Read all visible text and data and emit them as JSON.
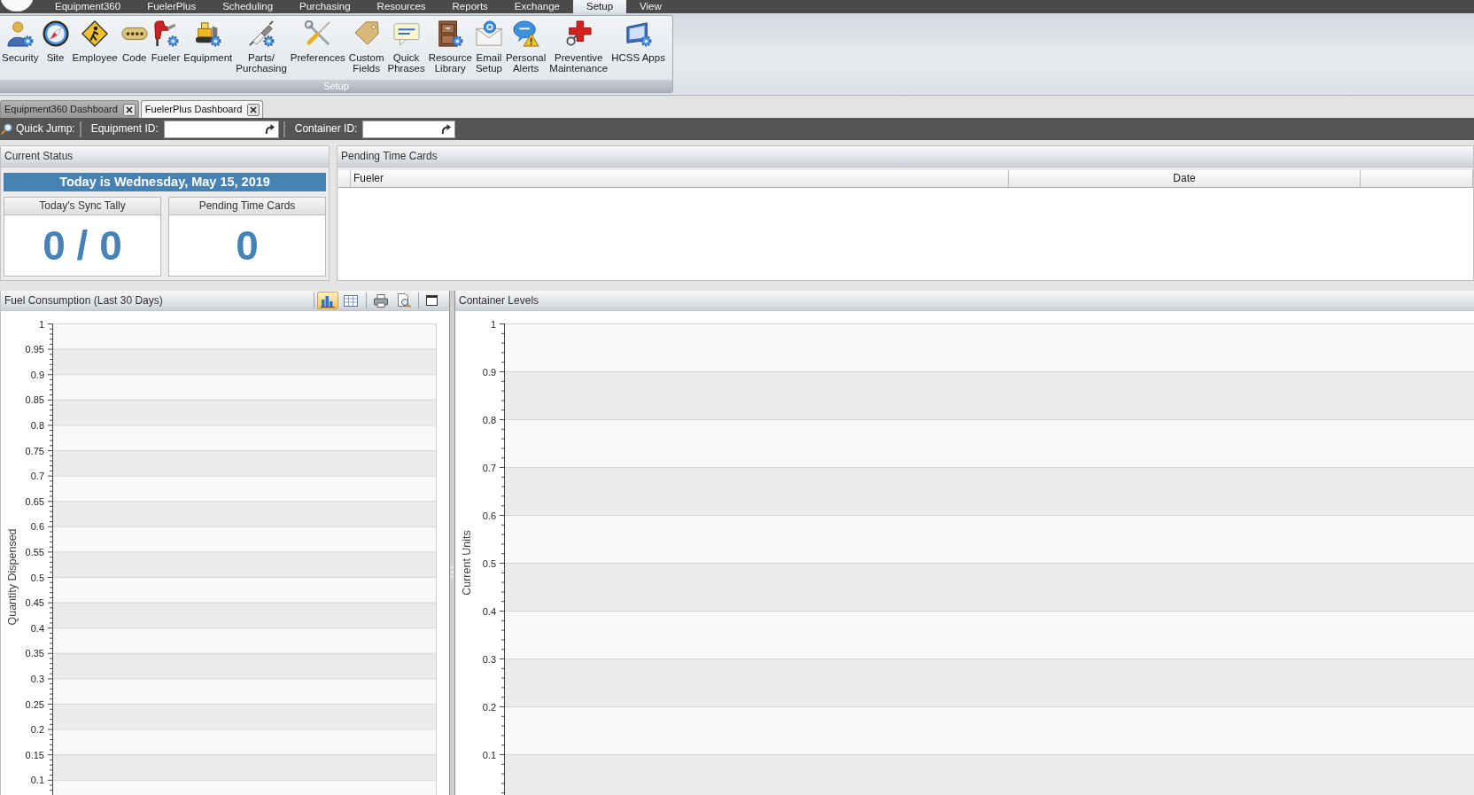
{
  "menu": [
    {
      "label": "Equipment360",
      "selected": false
    },
    {
      "label": "FuelerPlus",
      "selected": false
    },
    {
      "label": "Scheduling",
      "selected": false
    },
    {
      "label": "Purchasing",
      "selected": false
    },
    {
      "label": "Resources",
      "selected": false
    },
    {
      "label": "Reports",
      "selected": false
    },
    {
      "label": "Exchange",
      "selected": false
    },
    {
      "label": "Setup",
      "selected": true
    },
    {
      "label": "View",
      "selected": false
    }
  ],
  "ribbon": {
    "group": "Setup",
    "buttons": [
      {
        "lines": [
          "Security"
        ]
      },
      {
        "lines": [
          "Site"
        ]
      },
      {
        "lines": [
          "Employee"
        ]
      },
      {
        "lines": [
          "Code"
        ]
      },
      {
        "lines": [
          "Fueler"
        ]
      },
      {
        "lines": [
          "Equipment"
        ]
      },
      {
        "lines": [
          "Parts/",
          "Purchasing"
        ]
      },
      {
        "lines": [
          "Preferences"
        ]
      },
      {
        "lines": [
          "Custom",
          "Fields"
        ]
      },
      {
        "lines": [
          "Quick",
          "Phrases"
        ]
      },
      {
        "lines": [
          "Resource",
          "Library"
        ]
      },
      {
        "lines": [
          "Email",
          "Setup"
        ]
      },
      {
        "lines": [
          "Personal",
          "Alerts"
        ]
      },
      {
        "lines": [
          "Preventive",
          "Maintenance"
        ]
      },
      {
        "lines": [
          "HCSS Apps"
        ]
      }
    ]
  },
  "document_tabs": [
    {
      "label": "Equipment360 Dashboard",
      "selected": false
    },
    {
      "label": "FuelerPlus Dashboard",
      "selected": true
    }
  ],
  "quick_jump": {
    "label": "Quick Jump:",
    "fields": [
      {
        "label": "Equipment ID:"
      },
      {
        "label": "Container ID:"
      }
    ]
  },
  "current_status": {
    "title": "Current Status",
    "date_banner": "Today is Wednesday, May 15, 2019",
    "tiles": [
      {
        "title": "Today's Sync Tally",
        "value": "0 / 0"
      },
      {
        "title": "Pending Time Cards",
        "value": "0"
      }
    ]
  },
  "pending_time_cards": {
    "title": "Pending Time Cards",
    "columns": [
      "Fueler",
      "Date"
    ]
  },
  "fuel_consumption": {
    "title": "Fuel Consumption (Last 30 Days)",
    "view_buttons": [
      {
        "selected": true
      },
      {
        "selected": false
      }
    ],
    "y_axis": {
      "title": "Quantity Dispensed",
      "labels": [
        "1",
        "0.95",
        "0.9",
        "0.85",
        "0.8",
        "0.75",
        "0.7",
        "0.65",
        "0.6",
        "0.55",
        "0.5",
        "0.45",
        "0.4",
        "0.35",
        "0.3",
        "0.25",
        "0.2",
        "0.15",
        "0.1"
      ]
    }
  },
  "container_levels": {
    "title": "Container Levels",
    "y_axis": {
      "title": "Current Units",
      "labels": [
        "1",
        "0.9",
        "0.8",
        "0.7",
        "0.6",
        "0.5",
        "0.4",
        "0.3",
        "0.2",
        "0.1"
      ]
    }
  }
}
